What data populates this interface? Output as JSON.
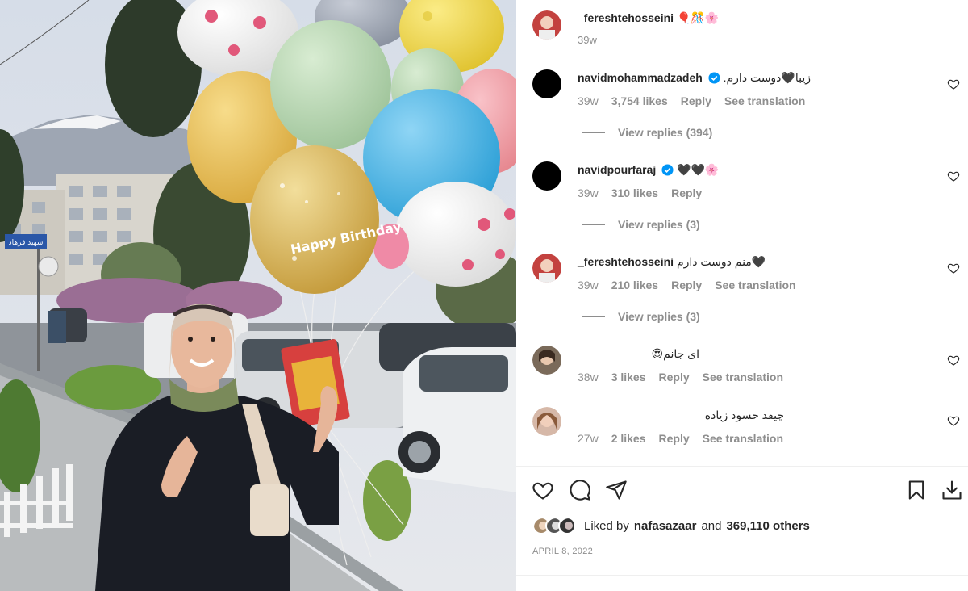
{
  "post": {
    "author": "_fereshtehosseini",
    "author_emoji": "🎈🎊🌸",
    "time": "39w"
  },
  "comments": [
    {
      "user": "navidmohammadzadeh",
      "verified": true,
      "text": ".زیبا🖤دوست دارم",
      "time": "39w",
      "likes": "3,754 likes",
      "reply": "Reply",
      "translate": "See translation",
      "replies": "View replies (394)"
    },
    {
      "user": "navidpourfaraj",
      "verified": true,
      "text": "🖤🖤🌸",
      "time": "39w",
      "likes": "310 likes",
      "reply": "Reply",
      "replies": "View replies (3)"
    },
    {
      "user": "_fereshtehosseini",
      "verified": false,
      "text": "منم دوست دارم🖤",
      "time": "39w",
      "likes": "210 likes",
      "reply": "Reply",
      "translate": "See translation",
      "replies": "View replies (3)"
    },
    {
      "user": "",
      "text": "ای جانم😍",
      "time": "38w",
      "likes": "3 likes",
      "reply": "Reply",
      "translate": "See translation"
    },
    {
      "user": "",
      "text": "چیقد حسود زیاده",
      "time": "27w",
      "likes": "2 likes",
      "reply": "Reply",
      "translate": "See translation"
    }
  ],
  "actions": {
    "like_icon": "heart-icon",
    "comment_icon": "comment-icon",
    "share_icon": "send-icon",
    "save_icon": "bookmark-icon",
    "download_icon": "download-icon"
  },
  "likes_summary": {
    "prefix": "Liked by",
    "user": "nafasazaar",
    "middle": "and",
    "others": "369,110 others"
  },
  "date": "APRIL 8, 2022",
  "photo": {
    "balloon_text": "Happy Birthday",
    "street_sign": "شهید فرهاد"
  },
  "colors": {
    "accent": "#0095f6",
    "muted": "#8e8e8e",
    "text": "#262626"
  }
}
